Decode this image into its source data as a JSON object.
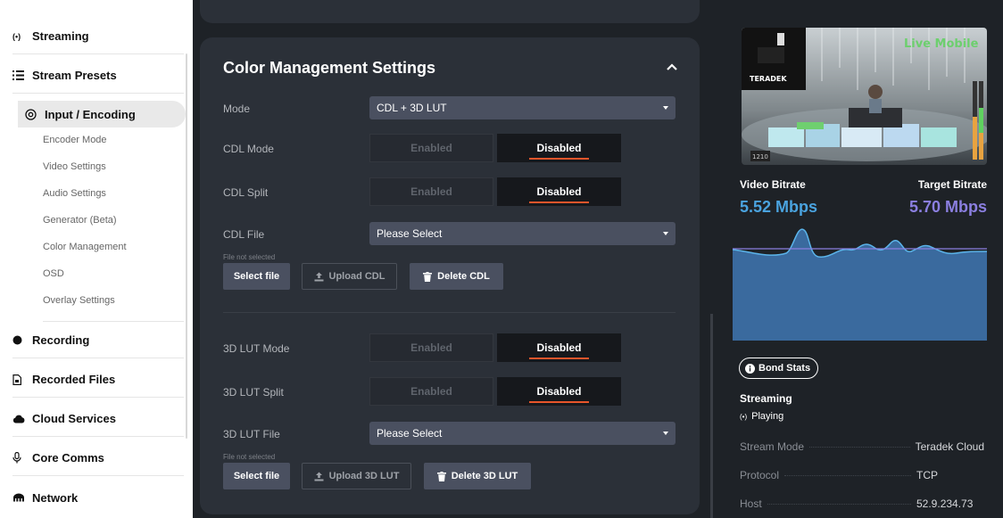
{
  "sidebar": {
    "main_items": [
      {
        "label": "Streaming",
        "icon": "broadcast-icon"
      },
      {
        "label": "Stream Presets",
        "icon": "list-icon"
      },
      {
        "label": "Input / Encoding",
        "icon": "input-icon"
      },
      {
        "label": "Recording",
        "icon": "record-icon"
      },
      {
        "label": "Recorded Files",
        "icon": "file-icon"
      },
      {
        "label": "Cloud Services",
        "icon": "cloud-icon"
      },
      {
        "label": "Core Comms",
        "icon": "microphone-icon"
      },
      {
        "label": "Network",
        "icon": "network-icon"
      }
    ],
    "sub_items": [
      "Encoder Mode",
      "Video Settings",
      "Audio Settings",
      "Generator (Beta)",
      "Color Management",
      "OSD",
      "Overlay Settings"
    ]
  },
  "color_management": {
    "title": "Color Management Settings",
    "mode_label": "Mode",
    "mode_value": "CDL + 3D LUT",
    "cdl_mode_label": "CDL Mode",
    "cdl_split_label": "CDL Split",
    "cdl_file_label": "CDL File",
    "cdl_file_value": "Please Select",
    "lut_mode_label": "3D LUT Mode",
    "lut_split_label": "3D LUT Split",
    "lut_file_label": "3D LUT File",
    "lut_file_value": "Please Select",
    "enabled": "Enabled",
    "disabled": "Disabled",
    "file_not_selected": "File not selected",
    "select_file": "Select file",
    "upload_cdl": "Upload CDL",
    "delete_cdl": "Delete CDL",
    "upload_lut": "Upload 3D LUT",
    "delete_lut": "Delete 3D LUT"
  },
  "preview": {
    "logo_text": "TERADEK",
    "overlay_text": "Live Mobile",
    "counter": "1210"
  },
  "stats": {
    "video_bitrate_label": "Video Bitrate",
    "video_bitrate_value": "5.52 Mbps",
    "target_bitrate_label": "Target Bitrate",
    "target_bitrate_value": "5.70 Mbps",
    "bond_stats": "Bond Stats",
    "streaming_label": "Streaming",
    "playing": "Playing",
    "rows": [
      {
        "key": "Stream Mode",
        "value": "Teradek Cloud"
      },
      {
        "key": "Protocol",
        "value": "TCP"
      },
      {
        "key": "Host",
        "value": "52.9.234.73"
      }
    ]
  },
  "colors": {
    "video_bitrate": "#4aa3df",
    "target_bitrate": "#8b7fe0",
    "accent": "#e8552b",
    "panel": "#2b3038",
    "background": "#1e2227"
  }
}
